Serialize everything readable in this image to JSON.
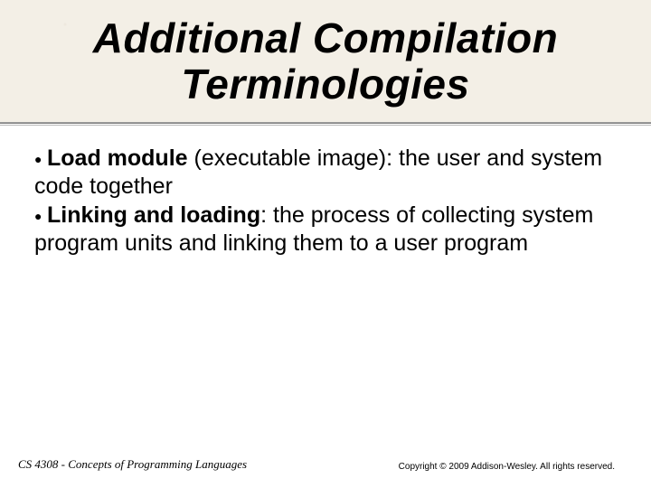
{
  "title": "Additional Compilation Terminologies",
  "bullets": [
    {
      "term": "Load module",
      "rest": " (executable image): the user and system code together"
    },
    {
      "term": "Linking and loading",
      "rest": ": the process of collecting system program units and linking them to a user program"
    }
  ],
  "footer": {
    "left": "CS 4308 - Concepts of Programming Languages",
    "right": "Copyright © 2009 Addison-Wesley. All rights reserved."
  }
}
